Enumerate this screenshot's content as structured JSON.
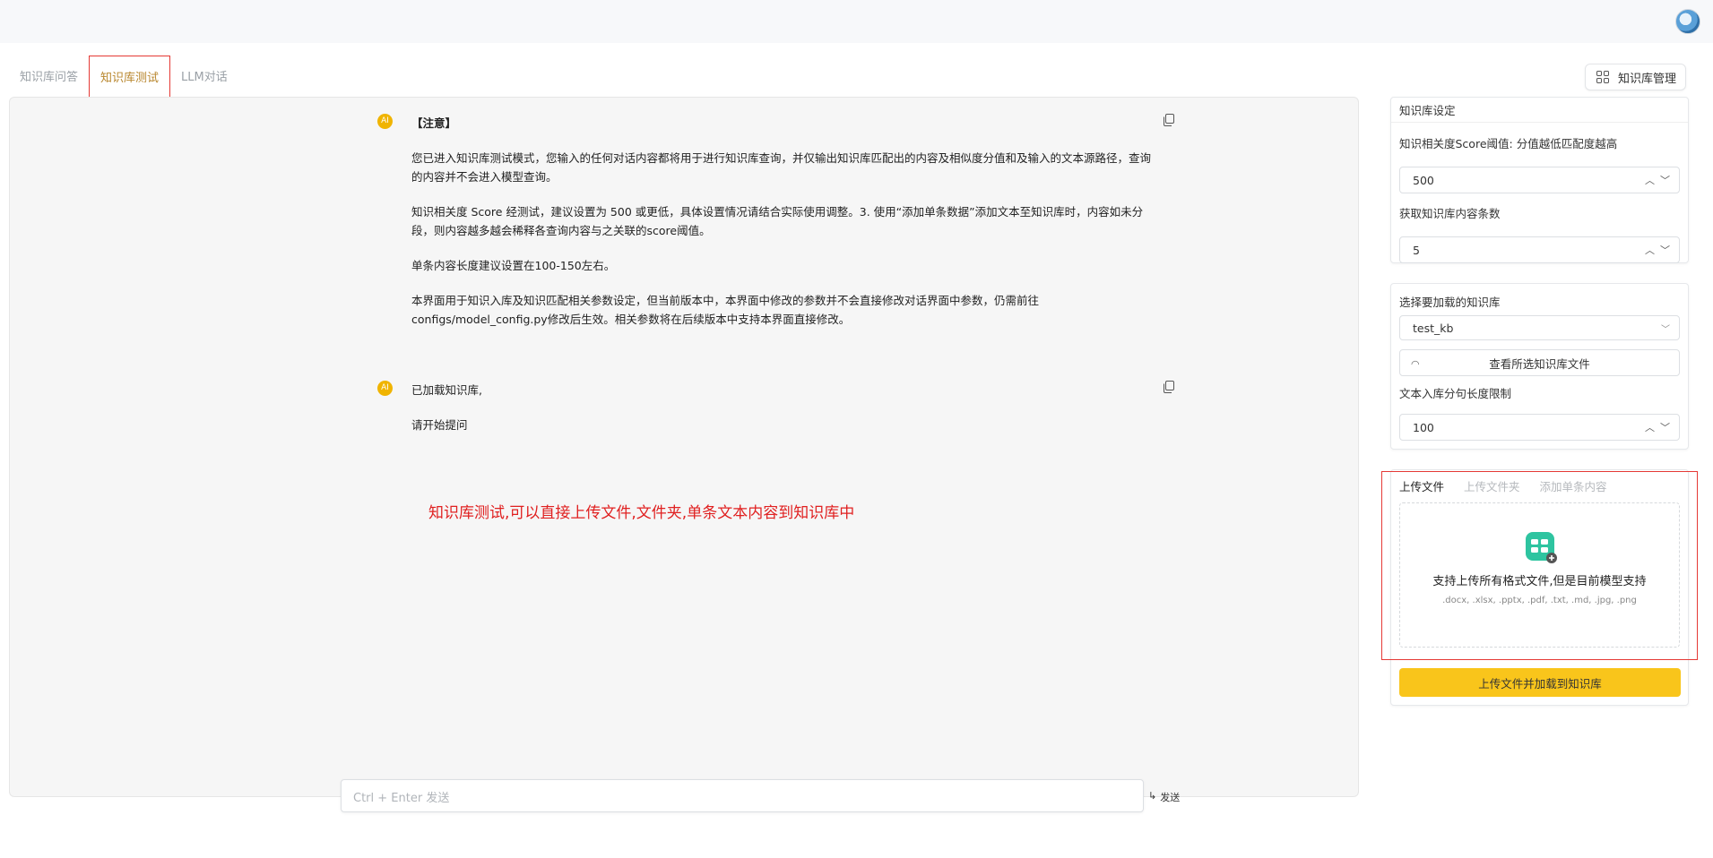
{
  "tabs": [
    {
      "label": "知识库问答",
      "active": false
    },
    {
      "label": "知识库测试",
      "active": true
    },
    {
      "label": "LLM对话",
      "active": false
    }
  ],
  "kb_manage_label": "知识库管理",
  "messages": [
    {
      "badge": "AI",
      "paragraphs": [
        "【注意】",
        "您已进入知识库测试模式，您输入的任何对话内容都将用于进行知识库查询，并仅输出知识库匹配出的内容及相似度分值和及输入的文本源路径，查询的内容并不会进入模型查询。",
        "知识相关度 Score 经测试，建议设置为 500 或更低，具体设置情况请结合实际使用调整。3. 使用“添加单条数据”添加文本至知识库时，内容如未分段，则内容越多越会稀释各查询内容与之关联的score阈值。",
        "单条内容长度建议设置在100-150左右。",
        "本界面用于知识入库及知识匹配相关参数设定，但当前版本中，本界面中修改的参数并不会直接修改对话界面中参数，仍需前往configs/model_config.py修改后生效。相关参数将在后续版本中支持本界面直接修改。"
      ]
    },
    {
      "badge": "AI",
      "paragraphs": [
        "已加载知识库,",
        "请开始提问"
      ]
    }
  ],
  "annotation": "知识库测试,可以直接上传文件,文件夹,单条文本内容到知识库中",
  "input": {
    "placeholder": "Ctrl + Enter 发送"
  },
  "send": {
    "icon": "↳",
    "label": "发送"
  },
  "settings": {
    "title": "知识库设定",
    "score_label": "知识相关度Score阈值: 分值越低匹配度越高",
    "score_value": "500",
    "count_label": "获取知识库内容条数",
    "count_value": "5"
  },
  "kb_select": {
    "label": "选择要加载的知识库",
    "value": "test_kb",
    "view_files_label": "查看所选知识库文件",
    "chunk_label": "文本入库分句长度限制",
    "chunk_value": "100"
  },
  "upload": {
    "tabs": [
      {
        "label": "上传文件",
        "active": true
      },
      {
        "label": "上传文件夹",
        "active": false
      },
      {
        "label": "添加单条内容",
        "active": false
      }
    ],
    "drop_title": "支持上传所有格式文件,但是目前模型支持",
    "drop_formats": ".docx, .xlsx, .pptx, .pdf, .txt, .md, .jpg, .png",
    "button_label": "上传文件并加载到知识库"
  },
  "colors": {
    "accent": "#f9c51b",
    "active_tab": "#b8862d",
    "annotation": "#e02020",
    "upload_icon": "#2ec4a0"
  }
}
